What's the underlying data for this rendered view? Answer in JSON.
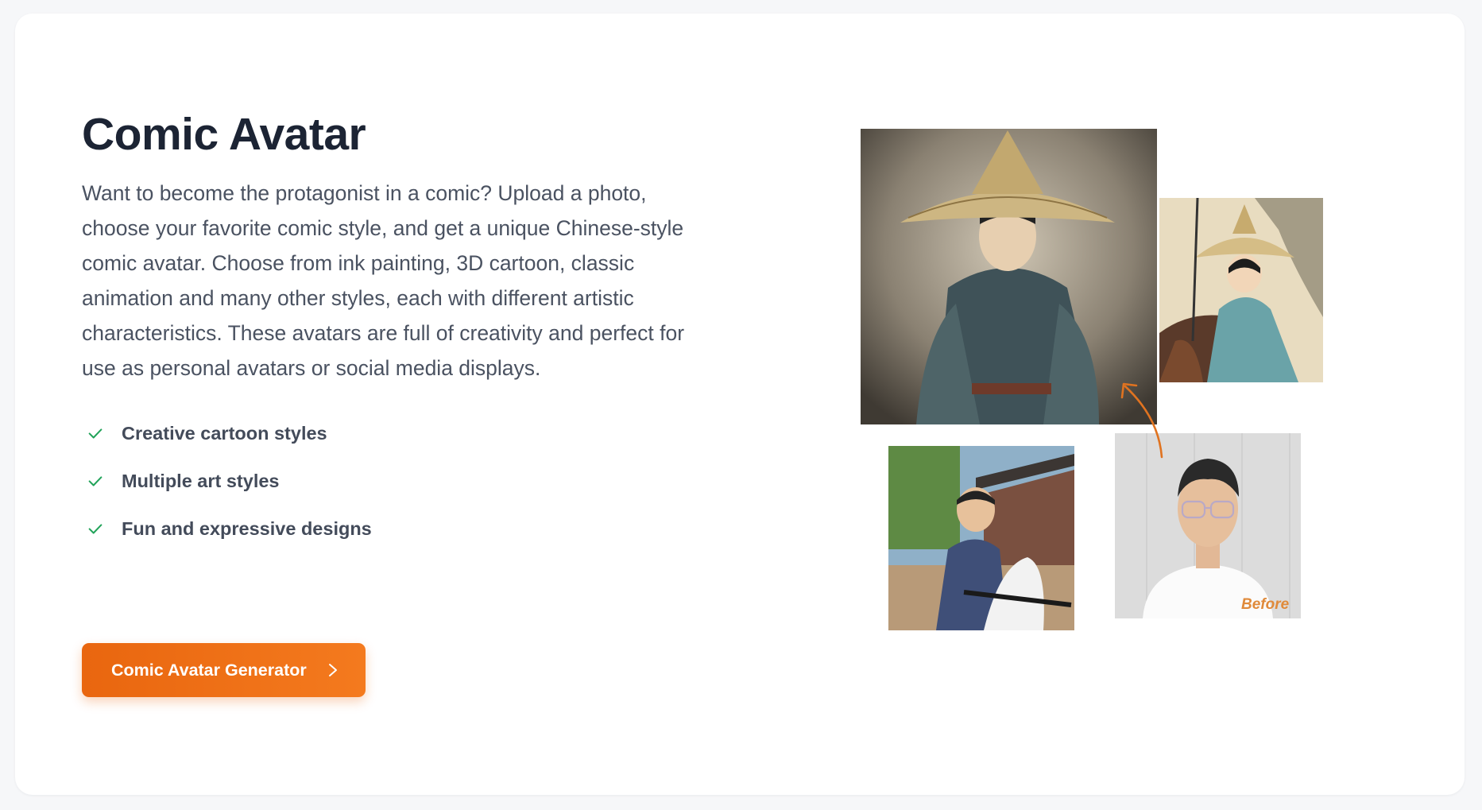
{
  "section": {
    "title": "Comic Avatar",
    "description": "Want to become the protagonist in a comic? Upload a photo, choose your favorite comic style, and get a unique Chinese-style comic avatar. Choose from ink painting, 3D cartoon, classic animation and many other styles, each with different artistic characteristics. These avatars are full of creativity and perfect for use as personal avatars or social media displays.",
    "features": [
      {
        "label": "Creative cartoon styles",
        "icon": "check-icon"
      },
      {
        "label": "Multiple art styles",
        "icon": "check-icon"
      },
      {
        "label": "Fun and expressive designs",
        "icon": "check-icon"
      }
    ],
    "cta": {
      "label": "Comic Avatar Generator",
      "icon": "chevron-right-icon"
    }
  },
  "gallery": {
    "before_label": "Before",
    "images": [
      {
        "name": "ink-painting-avatar",
        "icon": "ink-style-image"
      },
      {
        "name": "classic-animation-avatar",
        "icon": "anime-style-image"
      },
      {
        "name": "3d-cartoon-avatar",
        "icon": "3d-style-image"
      },
      {
        "name": "original-photo",
        "icon": "photo-image"
      }
    ]
  },
  "colors": {
    "accent": "#ef6f14",
    "check": "#22a35a",
    "title": "#1c2434",
    "body": "#4a5261",
    "before_label": "#e08a3a"
  }
}
